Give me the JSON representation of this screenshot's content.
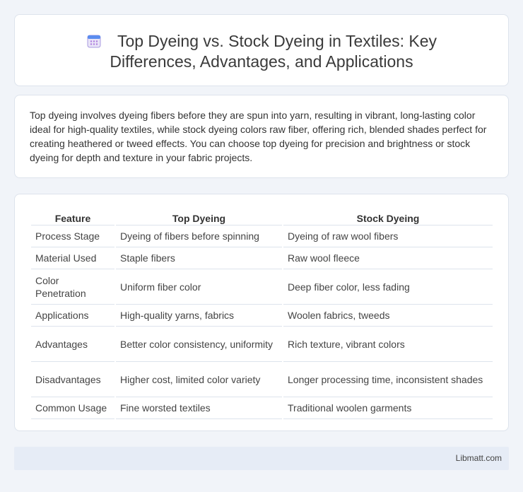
{
  "header": {
    "icon": "calendar-icon",
    "title": "Top Dyeing vs. Stock Dyeing in Textiles: Key Differences, Advantages, and Applications"
  },
  "intro": {
    "text": "Top dyeing involves dyeing fibers before they are spun into yarn, resulting in vibrant, long-lasting color ideal for high-quality textiles, while stock dyeing colors raw fiber, offering rich, blended shades perfect for creating heathered or tweed effects. You can choose top dyeing for precision and brightness or stock dyeing for depth and texture in your fabric projects."
  },
  "table": {
    "headers": [
      "Feature",
      "Top Dyeing",
      "Stock Dyeing"
    ],
    "rows": [
      [
        "Process Stage",
        "Dyeing of fibers before spinning",
        "Dyeing of raw wool fibers"
      ],
      [
        "Material Used",
        "Staple fibers",
        "Raw wool fleece"
      ],
      [
        "Color Penetration",
        "Uniform fiber color",
        "Deep fiber color, less fading"
      ],
      [
        "Applications",
        "High-quality yarns, fabrics",
        "Woolen fabrics, tweeds"
      ],
      [
        "Advantages",
        "Better color consistency, uniformity",
        "Rich texture, vibrant colors"
      ],
      [
        "Disadvantages",
        "Higher cost, limited color variety",
        "Longer processing time, inconsistent shades"
      ],
      [
        "Common Usage",
        "Fine worsted textiles",
        "Traditional woolen garments"
      ]
    ]
  },
  "footer": {
    "brand": "Libmatt.com"
  }
}
